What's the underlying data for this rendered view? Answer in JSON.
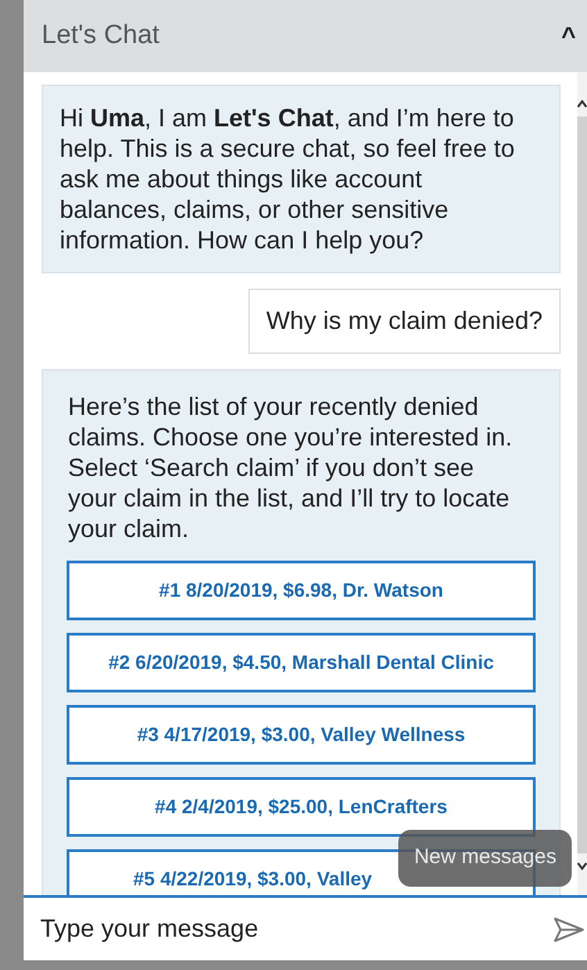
{
  "header": {
    "title": "Let's Chat",
    "collapse": "^"
  },
  "messages": [
    {
      "kind": "bot",
      "text": "Hi **Uma**, I am **Let's Chat**, and I’m here to help. This is a secure chat, so feel free to ask me about things like account balances, claims, or other sensitive information. How can I help you?"
    },
    {
      "kind": "user",
      "text": "Why is my claim denied?"
    },
    {
      "kind": "bot",
      "text": "Here’s the list of your recently denied claims. Choose one you’re interested in. Select ‘Search claim’ if you don’t see your claim in the list, and I’ll try to locate your claim.",
      "options": [
        "#1 8/20/2019, $6.98, Dr. Watson",
        "#2 6/20/2019, $4.50, Marshall Dental Clinic",
        "#3 4/17/2019, $3.00, Valley Wellness",
        "#4 2/4/2019, $25.00, LenCrafters",
        "#5 4/22/2019, $3.00, Valley"
      ]
    }
  ],
  "toast": "New messages",
  "composer": {
    "placeholder": "Type your message"
  }
}
